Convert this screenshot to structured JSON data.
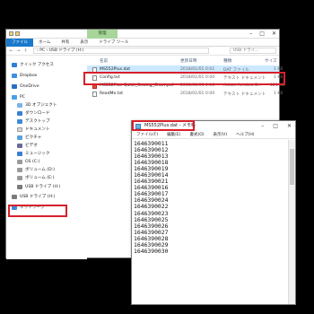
{
  "explorer": {
    "ribbon": {
      "manage_label": "管理",
      "tabs": [
        "ファイル",
        "ホーム",
        "共有",
        "表示",
        "ドライブ ツール"
      ]
    },
    "breadcrumb": "›  PC  ›  USB ドライブ (H:)",
    "search_placeholder": "USB ドライ...",
    "sidebar": {
      "items": [
        {
          "label": "クイック アクセス",
          "icon": "star-icon"
        },
        {
          "label": "Dropbox",
          "icon": "dropbox-icon"
        },
        {
          "label": "OneDrive",
          "icon": "cloud-icon"
        },
        {
          "label": "PC",
          "icon": "computer-icon"
        },
        {
          "label": "3D オブジェクト",
          "icon": "cube-icon"
        },
        {
          "label": "ダウンロード",
          "icon": "download-icon"
        },
        {
          "label": "デスクトップ",
          "icon": "desktop-icon"
        },
        {
          "label": "ドキュメント",
          "icon": "document-icon"
        },
        {
          "label": "ピクチャ",
          "icon": "picture-icon"
        },
        {
          "label": "ビデオ",
          "icon": "video-icon"
        },
        {
          "label": "ミュージック",
          "icon": "music-icon"
        },
        {
          "label": "OS (C:)",
          "icon": "drive-icon"
        },
        {
          "label": "ボリューム (D:)",
          "icon": "drive-icon"
        },
        {
          "label": "ボリューム (E:)",
          "icon": "drive-icon"
        },
        {
          "label": "USB ドライブ (H:)",
          "icon": "usb-drive-icon"
        },
        {
          "label": "USB ドライブ (H:)",
          "icon": "usb-drive-icon"
        },
        {
          "label": "ネットワーク",
          "icon": "network-icon"
        }
      ]
    },
    "columns": {
      "name": "名前",
      "date": "更新日時",
      "type": "種類",
      "size": "サイズ"
    },
    "files": [
      {
        "name": "MS552Plus.dat",
        "date": "2018/01/01 0:01",
        "type": "DAT ファイル",
        "size": "1 KB",
        "icon": "dat-file-icon"
      },
      {
        "name": "Config.txt",
        "date": "2018/01/01 0:00",
        "type": "テキスト ドキュメント",
        "size": "1 KB",
        "icon": "text-file-icon"
      },
      {
        "name": "MS552Plus-Quick_Setting_Chart.pdf",
        "date": "2018/01/01 0:00",
        "type": "Adobe Acrobat D...",
        "size": "121 KB",
        "icon": "pdf-file-icon"
      },
      {
        "name": "ReadMe.txt",
        "date": "2018/01/01 0:00",
        "type": "テキスト ドキュメント",
        "size": "1 KB",
        "icon": "text-file-icon"
      }
    ]
  },
  "notepad": {
    "title": "MS552Plus.dat - メモ帳",
    "menu": [
      "ファイル(F)",
      "編集(E)",
      "書式(O)",
      "表示(V)",
      "ヘルプ(H)"
    ],
    "lines": [
      "1646390011",
      "1646390012",
      "1646390013",
      "1646390018",
      "1646390019",
      "1646390014",
      "1646390021",
      "1646390016",
      "1646390017",
      "1646390024",
      "1646390022",
      "1646390023",
      "1646390025",
      "1646390026",
      "1646390027",
      "1646390028",
      "1646390029",
      "1646390030"
    ]
  },
  "colors": {
    "highlight": "#d6202a",
    "selection": "#cce8ff",
    "file_tab": "#1979ca",
    "manage_tab": "#a8d59a"
  }
}
